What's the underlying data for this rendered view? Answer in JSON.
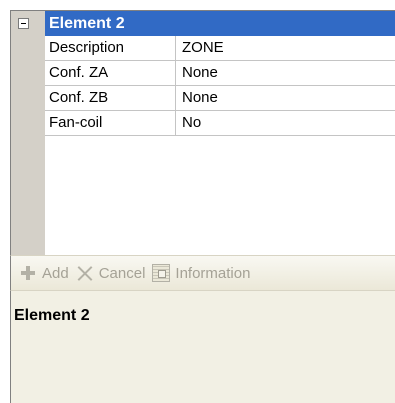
{
  "property_grid": {
    "group": {
      "title": "Element 2",
      "expanded": true
    },
    "rows": [
      {
        "name": "Description",
        "value": "ZONE"
      },
      {
        "name": "Conf. ZA",
        "value": "None"
      },
      {
        "name": "Conf. ZB",
        "value": "None"
      },
      {
        "name": "Fan-coil",
        "value": "No"
      }
    ]
  },
  "toolbar": {
    "add_label": "Add",
    "add_icon": "plus-icon",
    "cancel_label": "Cancel",
    "cancel_icon": "cross-icon",
    "information_label": "Information",
    "information_icon": "info-icon",
    "enabled": false
  },
  "description_panel": {
    "title": "Element 2"
  },
  "colors": {
    "selection": "#316ac5",
    "gutter": "#d4d0c8",
    "disabled_text": "#a5a296",
    "description_bg": "#f2f0e4"
  }
}
